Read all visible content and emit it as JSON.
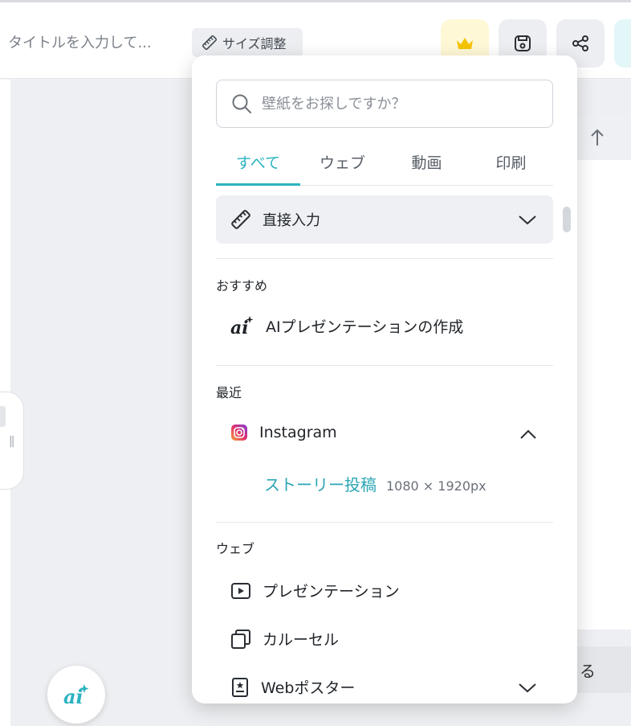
{
  "header": {
    "title_placeholder": "タイトルを入力して...",
    "size_button_label": "サイズ調整",
    "crown_icon": "crown-icon",
    "save_icon": "save-icon",
    "share_icon": "share-icon"
  },
  "dropdown": {
    "search_placeholder": "壁紙をお探しですか？",
    "tabs": [
      "すべて",
      "ウェブ",
      "動画",
      "印刷"
    ],
    "active_tab": "すべて",
    "direct_input_label": "直接入力",
    "recommended": {
      "label": "おすすめ",
      "items": [
        {
          "label": "AIプレゼンテーションの作成",
          "icon": "ai-icon"
        }
      ]
    },
    "recent": {
      "label": "最近",
      "group_label": "Instagram",
      "item_label": "ストーリー投稿",
      "item_size": "1080 × 1920px"
    },
    "web": {
      "label": "ウェブ",
      "items": [
        {
          "label": "プレゼンテーション",
          "icon": "play-icon"
        },
        {
          "label": "カルーセル",
          "icon": "copy-icon"
        },
        {
          "label": "Webポスター",
          "icon": "poster-icon"
        }
      ]
    }
  },
  "background": {
    "bottom_right_label": "る",
    "ai_fab_icon": "ai-icon"
  },
  "colors": {
    "accent": "#2bb3c0",
    "link": "#2ba5b4",
    "crown": "#f5c400"
  }
}
